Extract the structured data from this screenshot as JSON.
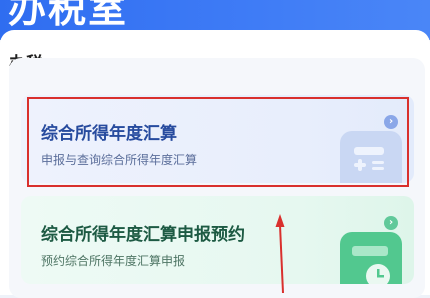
{
  "header": {
    "title": "办税室"
  },
  "section": {
    "title": "办税"
  },
  "cards": [
    {
      "title": "综合所得年度汇算",
      "subtitle": "申报与查询综合所得年度汇算",
      "accent": "#274b9e",
      "icon": "calculator-icon"
    },
    {
      "title": "综合所得年度汇算申报预约",
      "subtitle": "预约综合所得年度汇算申报",
      "accent": "#1d5a43",
      "icon": "calendar-clock-icon"
    }
  ],
  "annotation": {
    "box_color": "#d9302d",
    "arrow_color": "#d9302d"
  }
}
